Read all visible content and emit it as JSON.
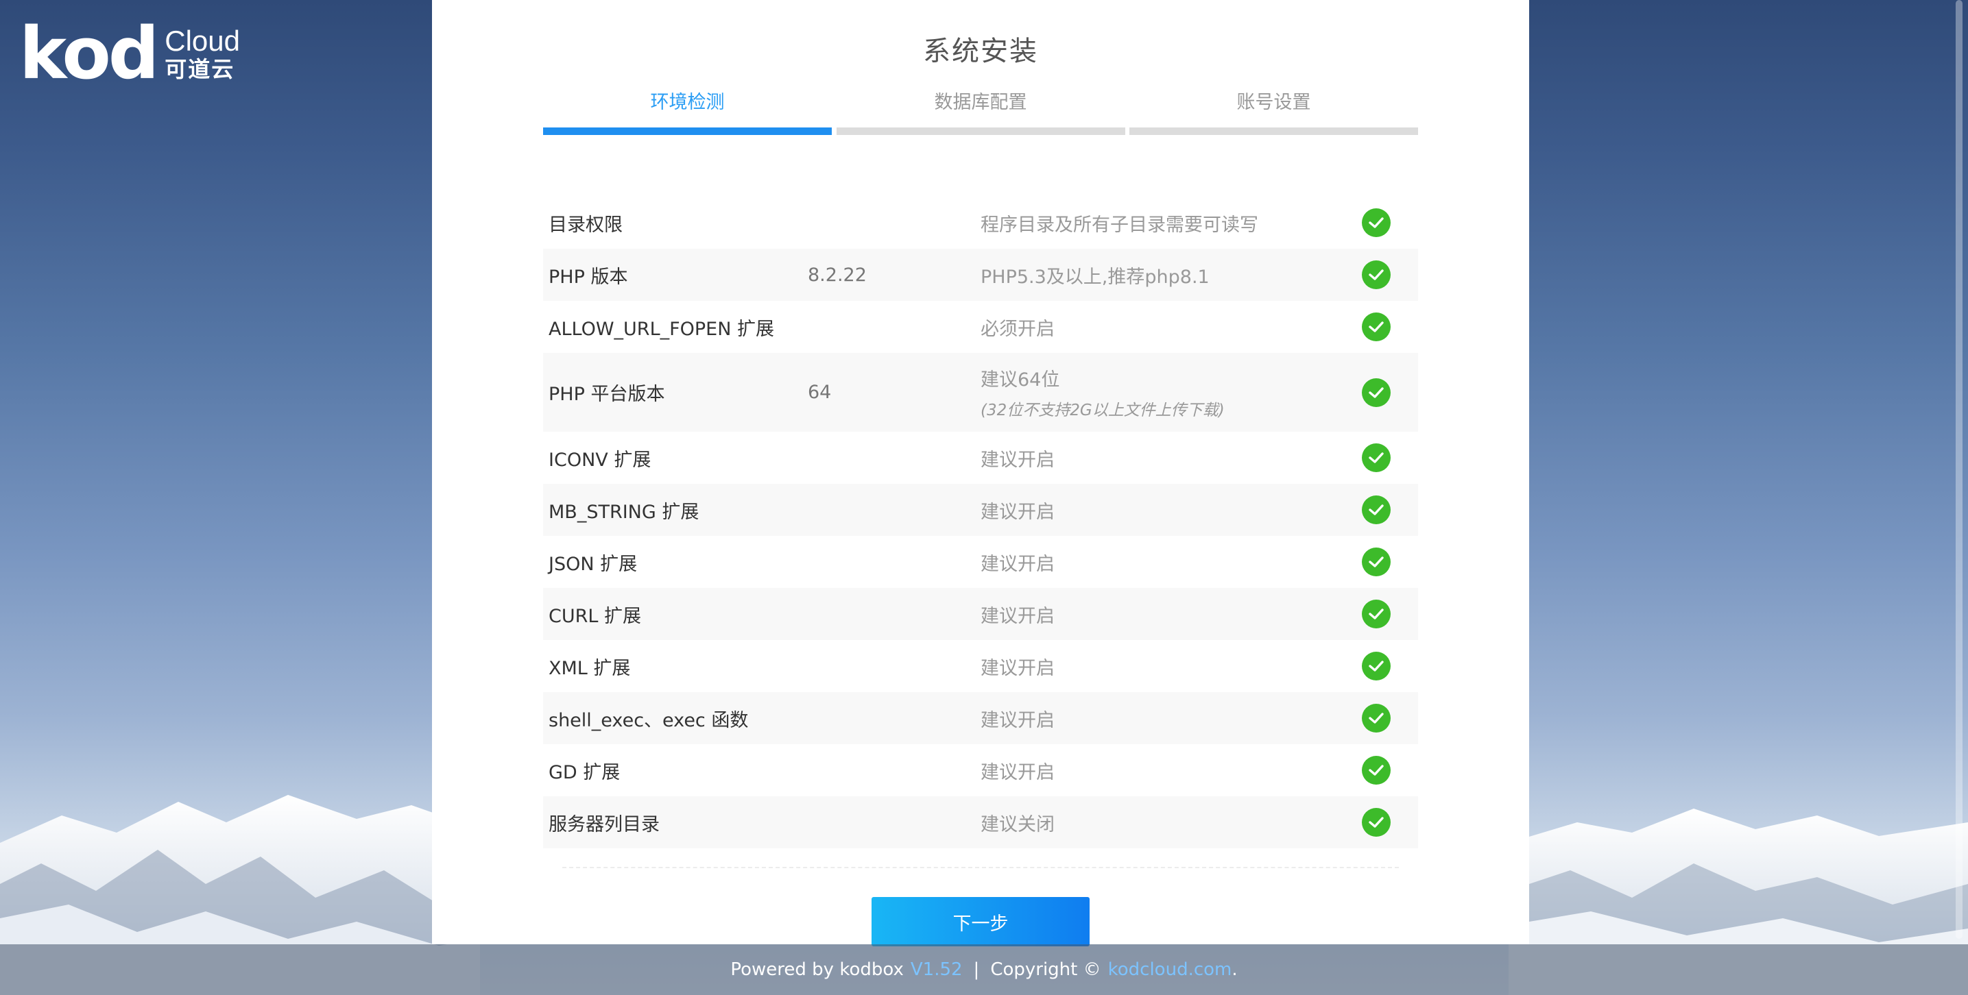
{
  "logo": {
    "mark": "kod",
    "brand": "Cloud",
    "brand_cn": "可道云"
  },
  "title": "系统安装",
  "steps": [
    {
      "label": "环境检测",
      "active": true
    },
    {
      "label": "数据库配置",
      "active": false
    },
    {
      "label": "账号设置",
      "active": false
    }
  ],
  "checks": [
    {
      "name": "目录权限",
      "value": "",
      "desc": "程序目录及所有子目录需要可读写",
      "note": ""
    },
    {
      "name": "PHP 版本",
      "value": "8.2.22",
      "desc": "PHP5.3及以上,推荐php8.1",
      "note": ""
    },
    {
      "name": "ALLOW_URL_FOPEN 扩展",
      "value": "",
      "desc": "必须开启",
      "note": ""
    },
    {
      "name": "PHP 平台版本",
      "value": "64",
      "desc": "建议64位",
      "note": "(32位不支持2G以上文件上传下载)"
    },
    {
      "name": "ICONV 扩展",
      "value": "",
      "desc": "建议开启",
      "note": ""
    },
    {
      "name": "MB_STRING 扩展",
      "value": "",
      "desc": "建议开启",
      "note": ""
    },
    {
      "name": "JSON 扩展",
      "value": "",
      "desc": "建议开启",
      "note": ""
    },
    {
      "name": "CURL 扩展",
      "value": "",
      "desc": "建议开启",
      "note": ""
    },
    {
      "name": "XML 扩展",
      "value": "",
      "desc": "建议开启",
      "note": ""
    },
    {
      "name": "shell_exec、exec 函数",
      "value": "",
      "desc": "建议开启",
      "note": ""
    },
    {
      "name": "GD 扩展",
      "value": "",
      "desc": "建议开启",
      "note": ""
    },
    {
      "name": "服务器列目录",
      "value": "",
      "desc": "建议关闭",
      "note": ""
    }
  ],
  "next_label": "下一步",
  "footer": {
    "powered": "Powered by kodbox",
    "version": "V1.52",
    "sep": "|",
    "copyright": "Copyright ©",
    "site": "kodcloud.com",
    "dot": "."
  },
  "colors": {
    "accent": "#1f8ff0",
    "check": "#3dbb2a"
  }
}
